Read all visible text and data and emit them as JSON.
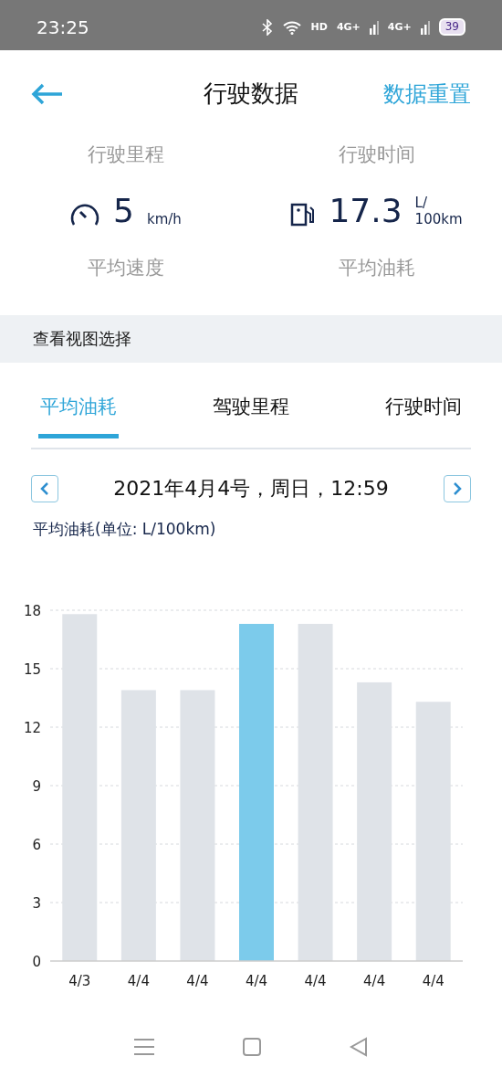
{
  "status_bar": {
    "time": "23:25",
    "hd": "HD",
    "networks": [
      "4G+",
      "4G+"
    ],
    "battery": "39"
  },
  "header": {
    "title": "行驶数据",
    "action": "数据重置"
  },
  "stats": {
    "top_labels": [
      "行驶里程",
      "行驶时间"
    ],
    "items": [
      {
        "kind": "speed",
        "value": "5",
        "unit": "km/h",
        "label": "平均速度"
      },
      {
        "kind": "fuel",
        "value": "17.3",
        "unit_top": "L/",
        "unit": "100km",
        "label": "平均油耗"
      }
    ]
  },
  "section": {
    "title": "查看视图选择"
  },
  "tabs": [
    {
      "label": "平均油耗",
      "selected": true
    },
    {
      "label": "驾驶里程",
      "selected": false
    },
    {
      "label": "行驶时间",
      "selected": false
    }
  ],
  "date_nav": {
    "date": "2021年4月4号，周日，12:59"
  },
  "chart_caption": "平均油耗(单位: L/100km)",
  "chart_data": {
    "type": "bar",
    "categories": [
      "4/3",
      "4/4",
      "4/4",
      "4/4",
      "4/4",
      "4/4",
      "4/4"
    ],
    "series": [
      {
        "color": "#dfe3e8",
        "values": [
          17.8,
          13.9,
          13.9,
          null,
          17.3,
          14.3,
          13.3
        ]
      },
      {
        "color": "#7ccbeb",
        "values": [
          null,
          null,
          null,
          17.3,
          null,
          null,
          null
        ]
      }
    ],
    "grid": true,
    "ylim": [
      0,
      18
    ],
    "yticks": [
      0,
      3,
      6,
      9,
      12,
      15,
      18
    ]
  }
}
